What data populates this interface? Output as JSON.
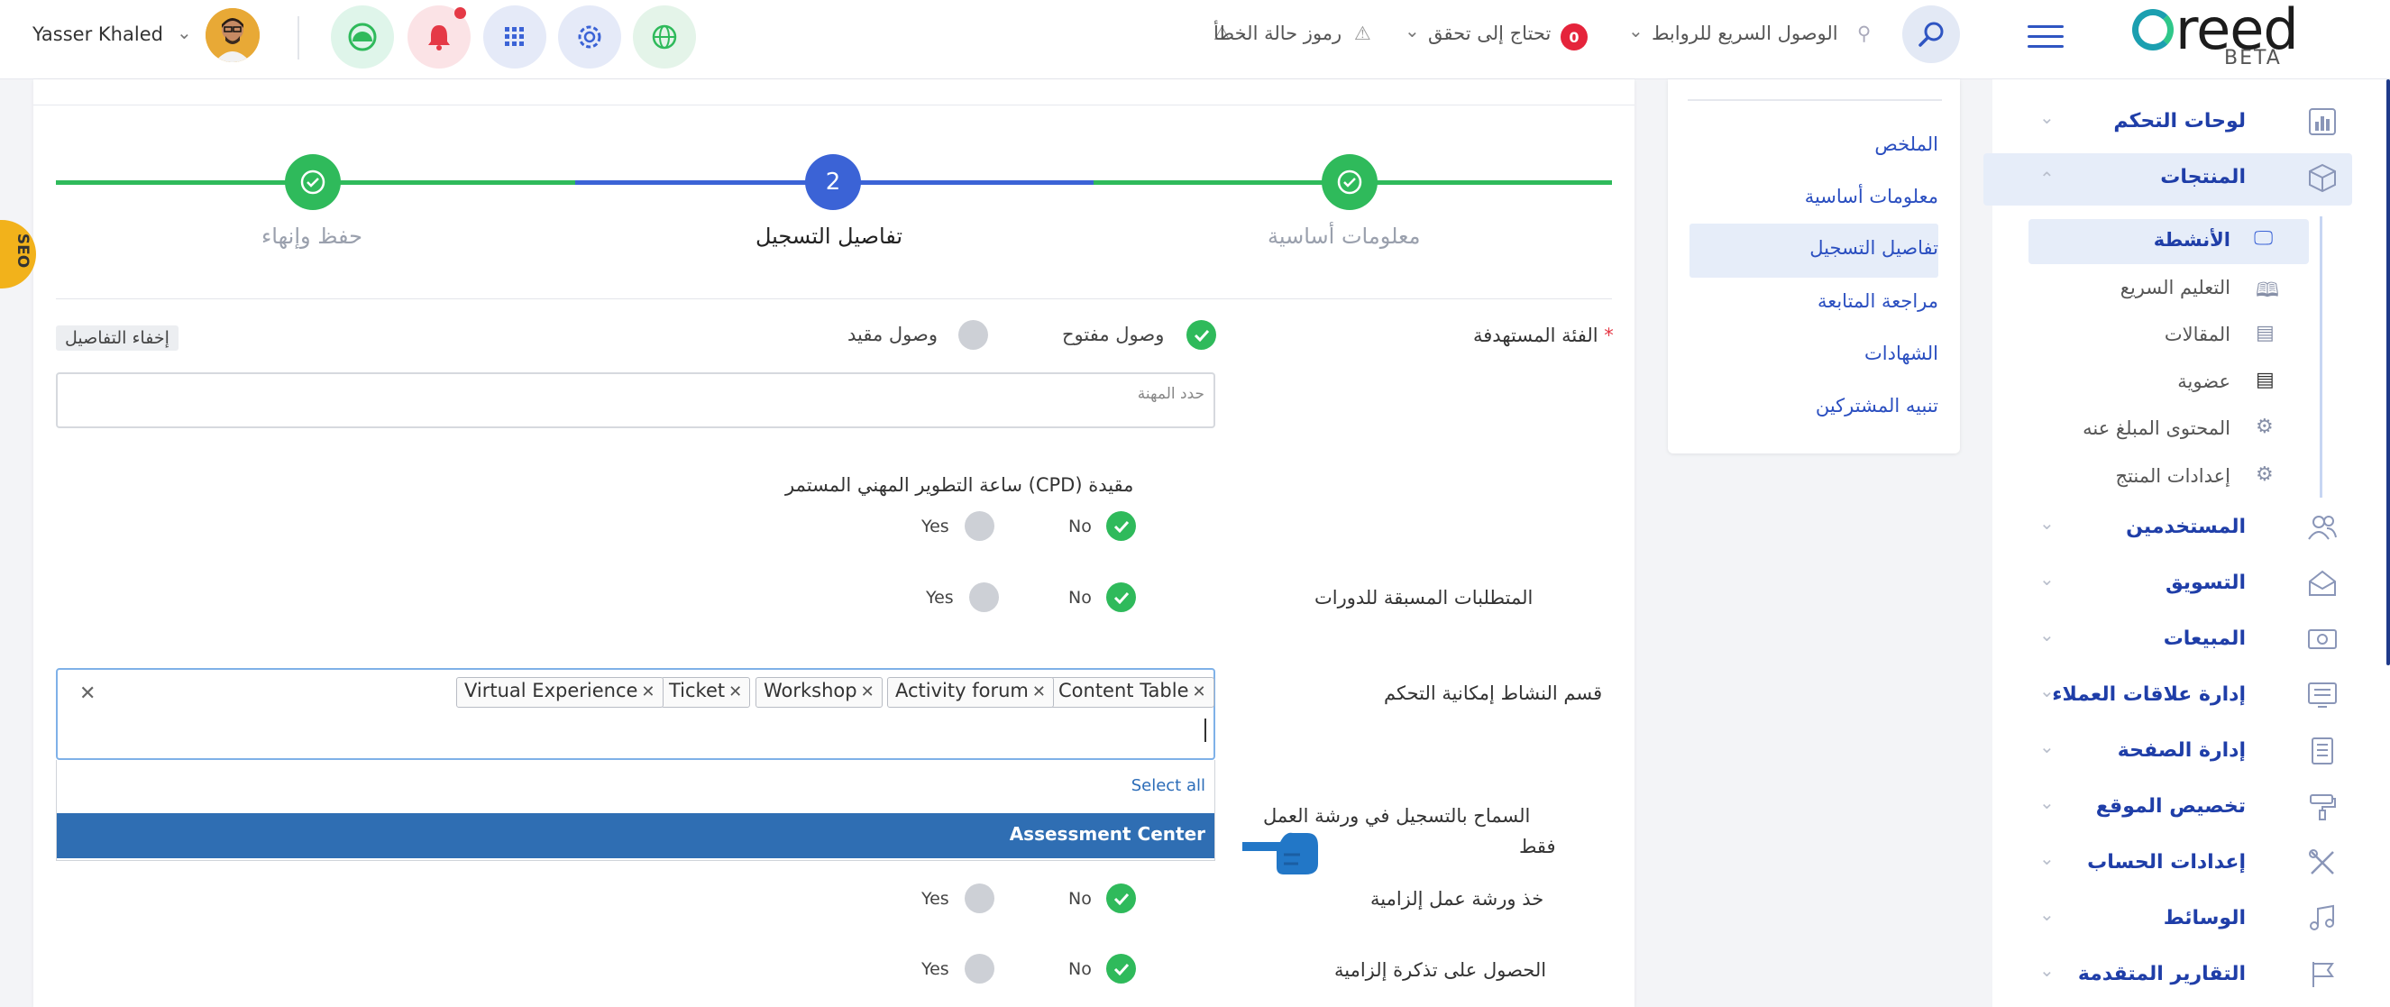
{
  "topbar": {
    "user_name": "Yasser Khaled",
    "quick_access": "الوصول السريع للروابط",
    "needs_check": "تحتاج إلى تحقق",
    "needs_check_count": "0",
    "error_codes": "رموز حالة الخطأ",
    "logo_text": "reed",
    "logo_sub": "BETA"
  },
  "sidebar": {
    "items": [
      {
        "label": "لوحات التحكم",
        "icon": "bar-chart-icon"
      },
      {
        "label": "المنتجات",
        "icon": "box-icon"
      },
      {
        "label": "المستخدمين",
        "icon": "users-icon"
      },
      {
        "label": "التسويق",
        "icon": "megaphone-icon"
      },
      {
        "label": "المبيعات",
        "icon": "money-icon"
      },
      {
        "label": "إدارة علاقات العملاء",
        "icon": "crm-icon"
      },
      {
        "label": "إدارة الصفحة",
        "icon": "pages-icon"
      },
      {
        "label": "تخصيص الموقع",
        "icon": "paint-roller-icon"
      },
      {
        "label": "إعدادات الحساب",
        "icon": "tools-icon"
      },
      {
        "label": "الوسائط",
        "icon": "music-icon"
      },
      {
        "label": "التقارير المتقدمة",
        "icon": "flag-icon"
      }
    ],
    "products_sub": [
      {
        "label": "الأنشطة"
      },
      {
        "label": "التعليم السريع"
      },
      {
        "label": "المقالات"
      },
      {
        "label": "عضوية"
      },
      {
        "label": "المحتوى المبلغ عنه"
      },
      {
        "label": "إعدادات المنتج"
      }
    ]
  },
  "steps_nav": {
    "items": [
      "الملخص",
      "معلومات أساسية",
      "تفاصيل التسجيل",
      "مراجعة المتابعة",
      "الشهادات",
      "تنبيه المشتركين"
    ]
  },
  "wizard": {
    "step1": "معلومات أساسية",
    "step2": "تفاصيل التسجيل",
    "step2_number": "2",
    "step3": "حفظ وإنهاء"
  },
  "form": {
    "target_audience_label": "الفئة المستهدفة",
    "required_mark": "*",
    "open_access": "وصول مفتوح",
    "restricted_access": "وصول مقيد",
    "hide_details": "إخفاء التفاصيل",
    "profession_placeholder": "حدد المهنة",
    "cpd_label": "ساعة التطوير المهني المستمر (CPD) مقيدة",
    "prereq_label": "المتطلبات المسبقة للدورات",
    "activity_section_label": "قسم النشاط إمكانية التحكم",
    "workshop_only_label_1": "السماح بالتسجيل في ورشة العمل",
    "workshop_only_label_2": "فقط",
    "mandatory_workshop_label": "خذ ورشة عمل إلزامية",
    "mandatory_ticket_label": "الحصول على تذكرة إلزامية",
    "yes": "Yes",
    "no": "No",
    "tags": [
      "Content Table",
      "Activity forum",
      "Workshop",
      "Ticket",
      "Virtual Experience"
    ],
    "select_all": "Select all",
    "highlighted_option": "Assessment Center"
  },
  "seo_tab": "SEO",
  "colors": {
    "accent_blue": "#3b63d6",
    "success_green": "#2fba5b",
    "sidebar_text": "#1f3ea8",
    "seo_yellow": "#f2b21b"
  }
}
